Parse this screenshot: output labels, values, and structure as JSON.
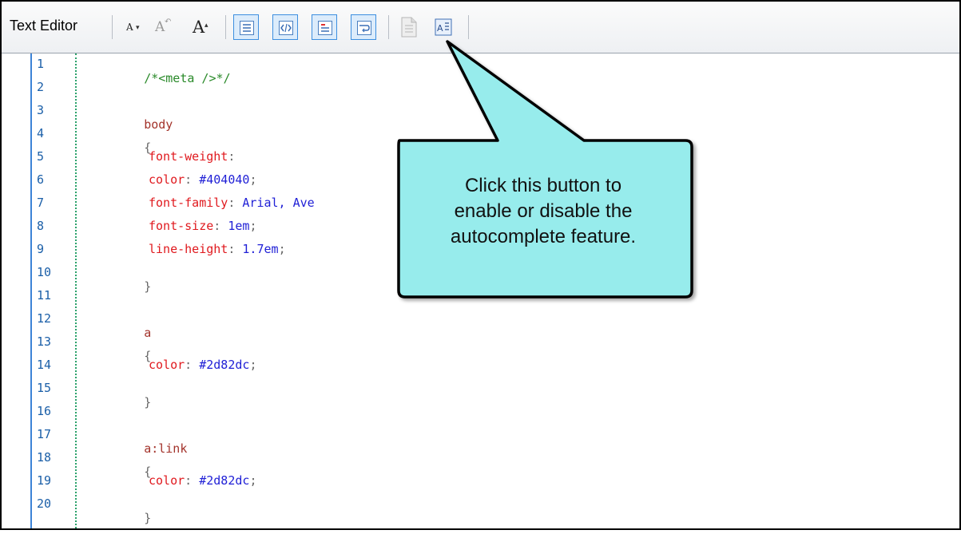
{
  "toolbar": {
    "label": "Text Editor",
    "font_small": "A",
    "font_default": "A",
    "font_large": "A",
    "buttons": [
      {
        "icon": "line-numbers-icon"
      },
      {
        "icon": "tag-mode-icon"
      },
      {
        "icon": "highlight-icon"
      },
      {
        "icon": "word-wrap-icon"
      },
      {
        "icon": "document-icon"
      },
      {
        "icon": "autocomplete-icon"
      }
    ]
  },
  "editor": {
    "lines": [
      {
        "n": "1"
      },
      {
        "n": "2"
      },
      {
        "n": "3"
      },
      {
        "n": "4"
      },
      {
        "n": "5"
      },
      {
        "n": "6"
      },
      {
        "n": "7"
      },
      {
        "n": "8"
      },
      {
        "n": "9"
      },
      {
        "n": "10"
      },
      {
        "n": "11"
      },
      {
        "n": "12"
      },
      {
        "n": "13"
      },
      {
        "n": "14"
      },
      {
        "n": "15"
      },
      {
        "n": "16"
      },
      {
        "n": "17"
      },
      {
        "n": "18"
      },
      {
        "n": "19"
      },
      {
        "n": "20"
      }
    ],
    "code": {
      "l1": "/*<meta />*/",
      "l3": "body",
      "l4": "{",
      "l5_prop": "font-weight",
      "l5_punct": ":",
      "l6_prop": "color",
      "l6_punct": ": ",
      "l6_val": "#404040",
      "l6_end": ";",
      "l7_prop": "font-family",
      "l7_punct": ": ",
      "l7_val": "Arial, Ave",
      "l8_prop": "font-size",
      "l8_punct": ": ",
      "l8_val": "1em",
      "l8_end": ";",
      "l9_prop": "line-height",
      "l9_punct": ": ",
      "l9_val": "1.7em",
      "l9_end": ";",
      "l10": "}",
      "l12": "a",
      "l13": "{",
      "l14_prop": "color",
      "l14_punct": ": ",
      "l14_val": "#2d82dc",
      "l14_end": ";",
      "l15": "}",
      "l17": "a:link",
      "l18": "{",
      "l19_prop": "color",
      "l19_punct": ": ",
      "l19_val": "#2d82dc",
      "l19_end": ";",
      "l20": "}"
    }
  },
  "callout": {
    "text_line1": "Click this button to",
    "text_line2": "enable or disable the",
    "text_line3": "autocomplete feature.",
    "fill": "#97ecec",
    "border": "#000000"
  }
}
